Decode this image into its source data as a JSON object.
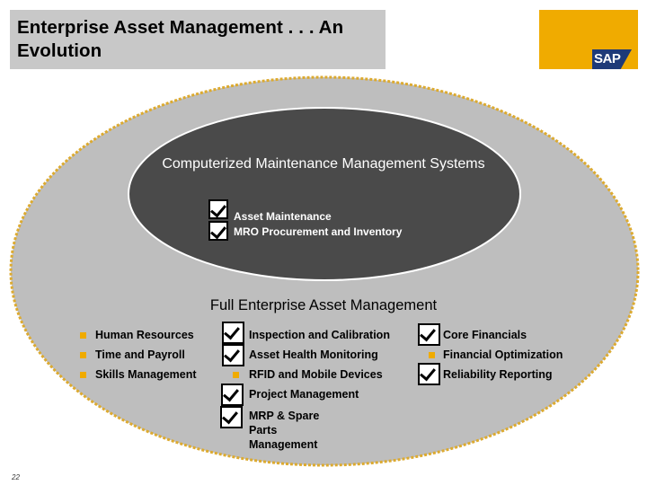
{
  "header": {
    "title": "Enterprise Asset Management . . .  An Evolution",
    "logo_text": "SAP",
    "logo_color": "#f0ab00"
  },
  "inner_ellipse": {
    "title": "Computerized Maintenance Management Systems",
    "items": [
      {
        "label": "Asset Maintenance",
        "marker": "checkbox-checked"
      },
      {
        "label": "MRO Procurement and Inventory",
        "marker": "checkbox-checked"
      }
    ]
  },
  "outer_ellipse": {
    "title": "Full Enterprise Asset Management",
    "columns": [
      [
        {
          "label": "Human Resources",
          "marker": "bullet"
        },
        {
          "label": "Time and Payroll",
          "marker": "bullet"
        },
        {
          "label": "Skills Management",
          "marker": "bullet"
        }
      ],
      [
        {
          "label": "Inspection and Calibration",
          "marker": "checkbox-checked"
        },
        {
          "label": "Asset Health Monitoring",
          "marker": "checkbox-checked"
        },
        {
          "label": "RFID and Mobile Devices",
          "marker": "bullet"
        },
        {
          "label": "Project Management",
          "marker": "checkbox-checked"
        },
        {
          "label": "MRP & Spare Parts Management",
          "marker": "checkbox-checked"
        }
      ],
      [
        {
          "label": "Core Financials",
          "marker": "checkbox-checked"
        },
        {
          "label": "Financial Optimization",
          "marker": "bullet"
        },
        {
          "label": "Reliability Reporting",
          "marker": "checkbox-checked"
        }
      ]
    ]
  },
  "footer": {
    "page_number": "22"
  },
  "colors": {
    "accent": "#f0ab00",
    "outer_fill": "#bebebe",
    "inner_fill": "#4a4a4a",
    "title_bar": "#c8c8c8"
  }
}
